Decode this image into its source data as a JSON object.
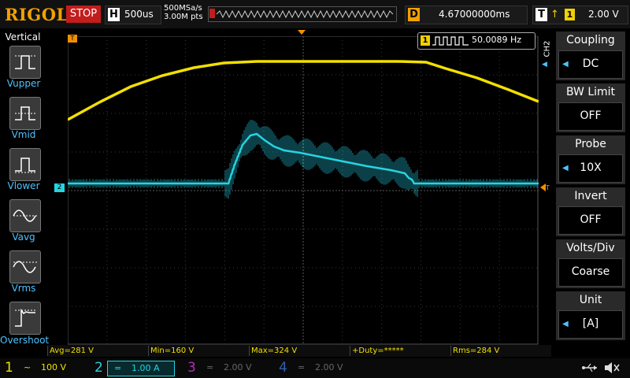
{
  "topbar": {
    "brand": "RIGOL",
    "run_state": "STOP",
    "horizontal_label": "H",
    "timebase": "500us",
    "sample_rate": "500MSa/s",
    "memory_depth": "3.00M pts",
    "delay_label": "D",
    "delay_value": "4.67000000ms",
    "trigger_label": "T",
    "trigger_edge": "rising",
    "trigger_source": "1",
    "trigger_level": "2.00 V"
  },
  "left_panel": {
    "title": "Vertical",
    "items": [
      {
        "label": "Vupper",
        "icon": "vupper-icon"
      },
      {
        "label": "Vmid",
        "icon": "vmid-icon"
      },
      {
        "label": "Vlower",
        "icon": "vlower-icon"
      },
      {
        "label": "Vavg",
        "icon": "vavg-icon"
      },
      {
        "label": "Vrms",
        "icon": "vrms-icon"
      },
      {
        "label": "Overshoot",
        "icon": "overshoot-icon"
      }
    ]
  },
  "right_panel": {
    "channel_tag": "CH2",
    "items": [
      {
        "title": "Coupling",
        "value": "DC"
      },
      {
        "title": "BW Limit",
        "value": "OFF"
      },
      {
        "title": "Probe",
        "value": "10X"
      },
      {
        "title": "Invert",
        "value": "OFF"
      },
      {
        "title": "Volts/Div",
        "value": "Coarse"
      },
      {
        "title": "Unit",
        "value": "[A]"
      }
    ]
  },
  "frequency_counter": {
    "channel": "1",
    "value": "50.0089 Hz"
  },
  "markers": {
    "trigger_marker": "T",
    "ch2_marker": "2"
  },
  "measurements": [
    "Avg=281 V",
    "Min=160 V",
    "Max=324 V",
    "+Duty=*****",
    "Rms=284 V"
  ],
  "channels": [
    {
      "num": "1",
      "coupling": "~",
      "scale": "100 V",
      "color": "#f2e000",
      "active": true
    },
    {
      "num": "2",
      "coupling": "=",
      "scale": "1.00 A",
      "color": "#26d4e0",
      "active": true
    },
    {
      "num": "3",
      "coupling": "=",
      "scale": "2.00 V",
      "color": "#b02fb0",
      "active": false
    },
    {
      "num": "4",
      "coupling": "=",
      "scale": "2.00 V",
      "color": "#2f5fb0",
      "active": false
    }
  ],
  "status_icons": [
    "usb-icon",
    "speaker-muted-icon"
  ],
  "colors": {
    "ch1": "#f2e000",
    "ch2": "#26d4e0",
    "trigger": "#f29000",
    "accent_blue": "#4ec3ff"
  }
}
